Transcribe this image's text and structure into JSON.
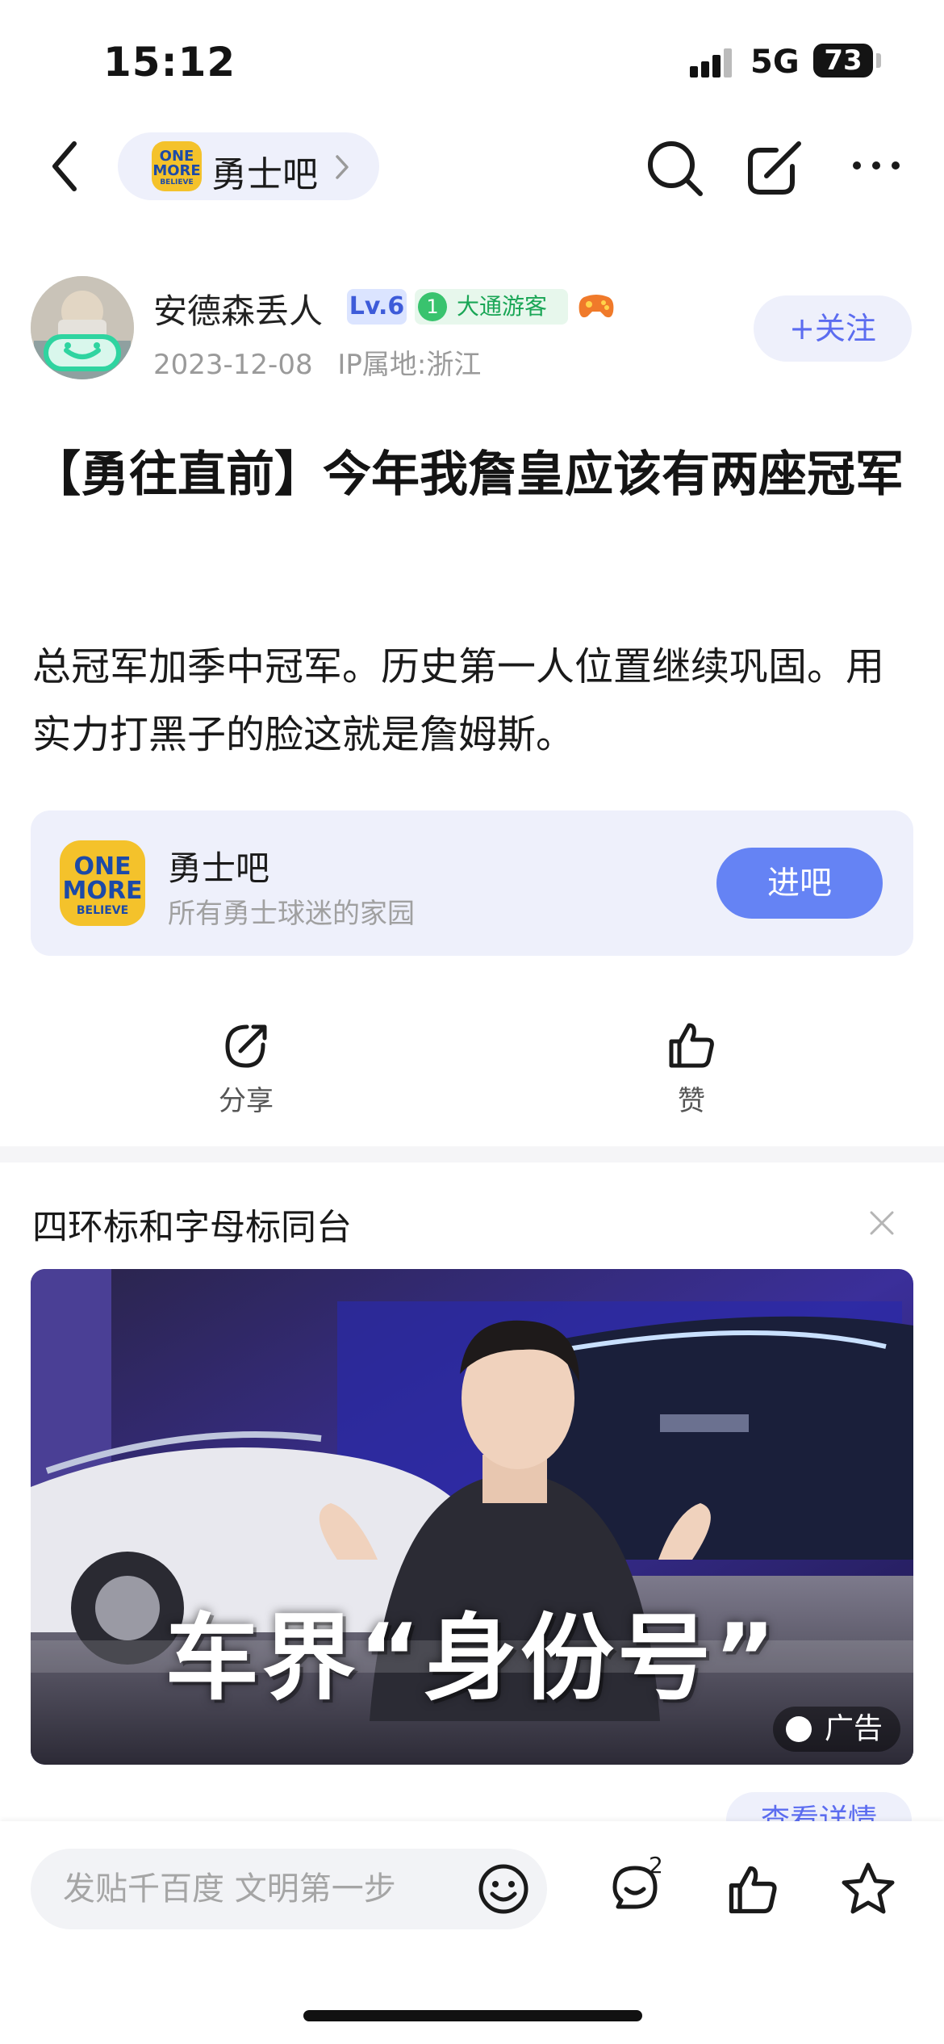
{
  "status_bar": {
    "time": "15:12",
    "network": "5G",
    "battery": "73"
  },
  "nav": {
    "forum_name": "勇士吧"
  },
  "forum_logo": {
    "line1": "ONE",
    "line2": "MORE",
    "line3": "BELIEVE"
  },
  "author": {
    "name": "安德森丢人",
    "level": "Lv.6",
    "member_level": "1",
    "member_title": "大通游客",
    "date": "2023-12-08",
    "ip_location": "IP属地:浙江",
    "follow_label": "+关注"
  },
  "post": {
    "title": "【勇往直前】今年我詹皇应该有两座冠军",
    "body": "总冠军加季中冠军。历史第一人位置继续巩固。用实力打黑子的脸这就是詹姆斯。"
  },
  "forum_card": {
    "name": "勇士吧",
    "description": "所有勇士球迷的家园",
    "enter_label": "进吧"
  },
  "actions": {
    "share_label": "分享",
    "like_label": "赞"
  },
  "ad": {
    "title": "四环标和字母标同台",
    "caption": "车界“身份号”",
    "tag": "广告",
    "more_label": "查看详情"
  },
  "bottom_bar": {
    "placeholder": "发贴千百度 文明第一步",
    "comment_count": "2"
  },
  "colors": {
    "accent": "#6583f4",
    "pill_bg": "#eef0fb",
    "member_green": "#1aa656"
  }
}
